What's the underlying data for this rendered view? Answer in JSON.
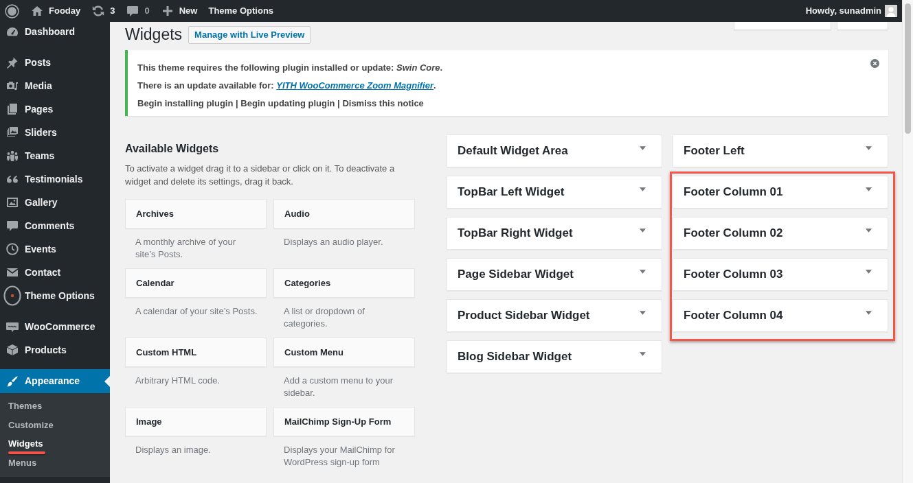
{
  "admin_bar": {
    "site_name": "Fooday",
    "updates": {
      "count": "3",
      "muted": false
    },
    "comments": {
      "count": "0",
      "muted": true
    },
    "new_label": "New",
    "links": [
      "Theme Options"
    ],
    "greeting": "Howdy, sunadmin"
  },
  "sidebar": {
    "groups": [
      [
        {
          "label": "Dashboard",
          "selected": false
        }
      ],
      [
        {
          "label": "Posts",
          "selected": false
        },
        {
          "label": "Media",
          "selected": false
        },
        {
          "label": "Pages",
          "selected": false
        },
        {
          "label": "Sliders",
          "selected": false
        },
        {
          "label": "Teams",
          "selected": false
        },
        {
          "label": "Testimonials",
          "selected": false
        },
        {
          "label": "Gallery",
          "selected": false
        },
        {
          "label": "Comments",
          "selected": false
        },
        {
          "label": "Events",
          "selected": false
        },
        {
          "label": "Contact",
          "selected": false
        },
        {
          "label": "Theme Options",
          "selected": false
        }
      ],
      [
        {
          "label": "WooCommerce",
          "selected": false
        },
        {
          "label": "Products",
          "selected": false
        }
      ],
      [
        {
          "label": "Appearance",
          "selected": true,
          "children": [
            {
              "label": "Themes",
              "selected": false,
              "highlighted": false
            },
            {
              "label": "Customize",
              "selected": false,
              "highlighted": false
            },
            {
              "label": "Widgets",
              "selected": true,
              "highlighted": true
            },
            {
              "label": "Menus",
              "selected": false,
              "highlighted": false
            }
          ]
        }
      ]
    ]
  },
  "page": {
    "title": "Widgets",
    "action": "Manage with Live Preview"
  },
  "notice": {
    "dismissible": true,
    "message": "This theme requires the following plugin installed or update: *Swin Core*.",
    "update": {
      "text": "There is an update available for: ",
      "link": "YITH WooCommerce Zoom Magnifier",
      "after": "."
    },
    "actions": [
      "Begin installing plugin",
      "Begin updating plugin",
      "Dismiss this notice"
    ],
    "separator": "|"
  },
  "available_widgets": {
    "title": "Available Widgets",
    "description": "To activate a widget drag it to a sidebar or click on it. To deactivate a widget and delete its settings, drag it back.",
    "widgets": [
      {
        "title": "Archives",
        "description": "A monthly archive of your site’s Posts."
      },
      {
        "title": "Audio",
        "description": "Displays an audio player."
      },
      {
        "title": "Calendar",
        "description": "A calendar of your site’s Posts."
      },
      {
        "title": "Categories",
        "description": "A list or dropdown of categories."
      },
      {
        "title": "Custom HTML",
        "description": "Arbitrary HTML code."
      },
      {
        "title": "Custom Menu",
        "description": "Add a custom menu to your sidebar."
      },
      {
        "title": "Image",
        "description": "Displays an image."
      },
      {
        "title": "MailChimp Sign-Up Form",
        "description": "Displays your MailChimp for WordPress sign-up form"
      }
    ]
  },
  "widget_areas": {
    "columns": [
      [
        {
          "title": "Default Widget Area",
          "expanded": false,
          "highlighted": false
        },
        {
          "title": "TopBar Left Widget",
          "expanded": false,
          "highlighted": false
        },
        {
          "title": "TopBar Right Widget",
          "expanded": false,
          "highlighted": false
        },
        {
          "title": "Page Sidebar Widget",
          "expanded": false,
          "highlighted": false
        },
        {
          "title": "Product Sidebar Widget",
          "expanded": false,
          "highlighted": false
        },
        {
          "title": "Blog Sidebar Widget",
          "expanded": false,
          "highlighted": false
        }
      ],
      [
        {
          "title": "Footer Left",
          "expanded": false,
          "highlighted": false
        },
        {
          "title": "Footer Column 01",
          "expanded": false,
          "highlighted": true
        },
        {
          "title": "Footer Column 02",
          "expanded": false,
          "highlighted": true
        },
        {
          "title": "Footer Column 03",
          "expanded": false,
          "highlighted": true
        },
        {
          "title": "Footer Column 04",
          "expanded": false,
          "highlighted": true
        }
      ]
    ]
  }
}
